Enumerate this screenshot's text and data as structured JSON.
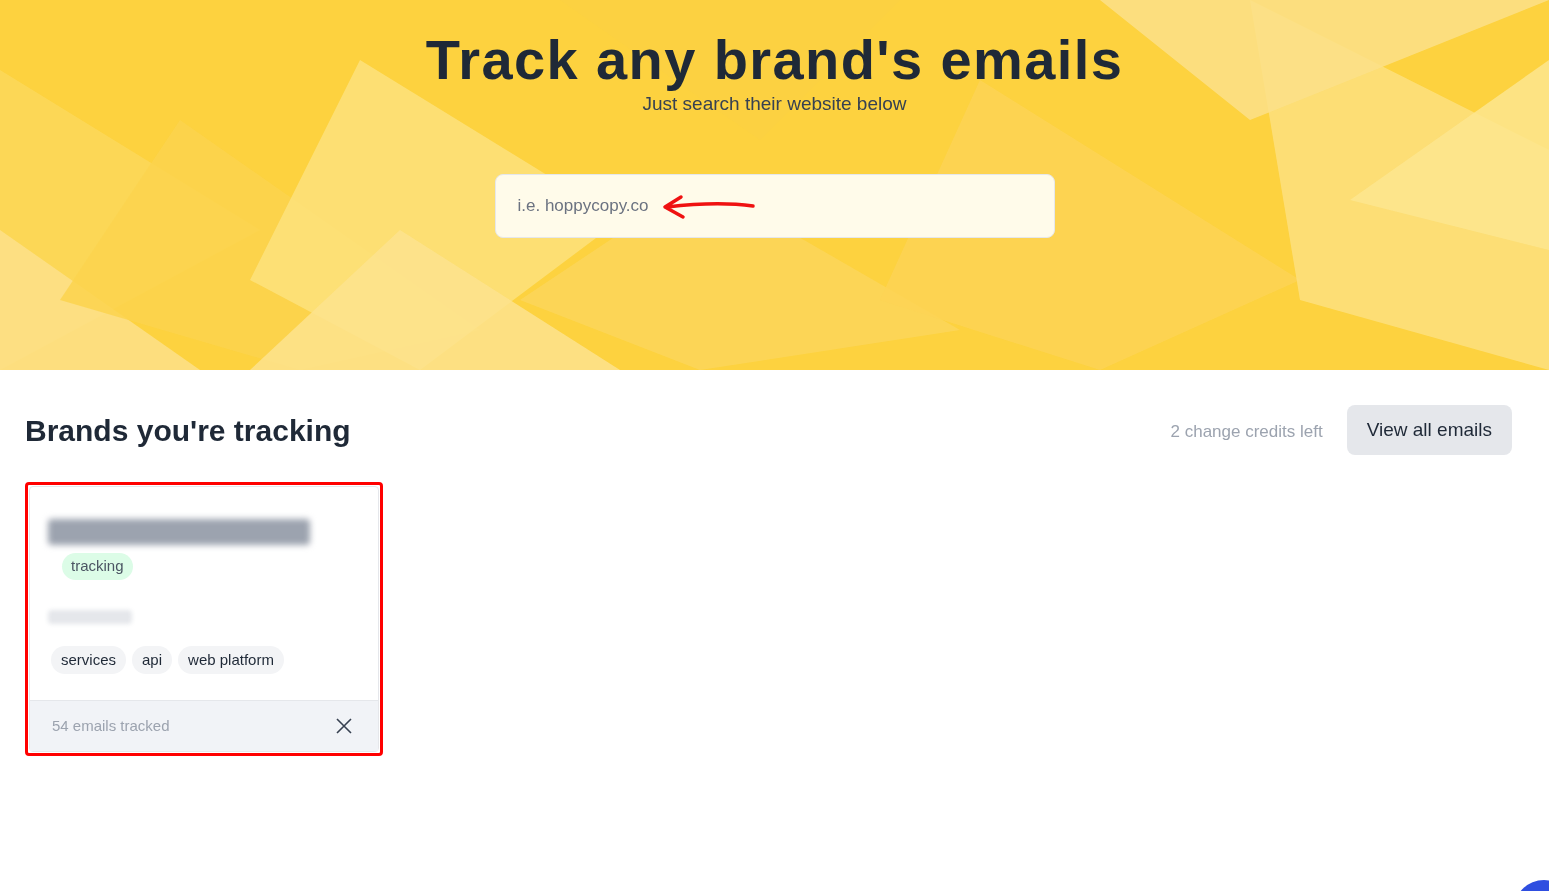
{
  "hero": {
    "title": "Track any brand's emails",
    "subtitle": "Just search their website below",
    "search": {
      "placeholder": "i.e. hoppycopy.co"
    }
  },
  "section": {
    "title": "Brands you're tracking",
    "credits": "2 change credits left",
    "button": "View all emails"
  },
  "brands": [
    {
      "status": "tracking",
      "tags": [
        "services",
        "api",
        "web platform"
      ],
      "footer": "54 emails tracked",
      "highlighted": true
    }
  ]
}
